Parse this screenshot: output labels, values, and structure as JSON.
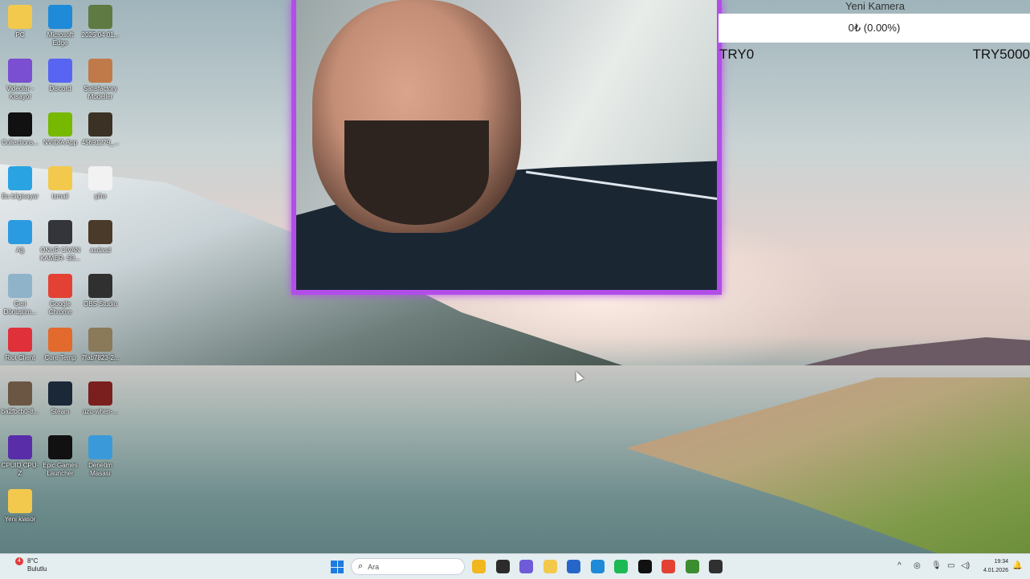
{
  "desktop": {
    "icons": [
      {
        "label": "PC",
        "icon": "folder-icon",
        "color": "#f2c94c"
      },
      {
        "label": "Microsoft Edge",
        "icon": "edge-icon",
        "color": "#1f8ad8"
      },
      {
        "label": "2025 04 01...",
        "icon": "image-file-icon",
        "color": "#5f7a42"
      },
      {
        "label": "Videolar - Kısayol",
        "icon": "video-folder-icon",
        "color": "#7a4fd1"
      },
      {
        "label": "Discord",
        "icon": "discord-icon",
        "color": "#5865f2"
      },
      {
        "label": "Satisfactory Modeller",
        "icon": "mug-icon",
        "color": "#c07a4a"
      },
      {
        "label": "Collections...",
        "icon": "black-window-icon",
        "color": "#111111"
      },
      {
        "label": "NVIDIA App",
        "icon": "nvidia-icon",
        "color": "#76b900"
      },
      {
        "label": "45691279_...",
        "icon": "image-file-icon",
        "color": "#3b3124"
      },
      {
        "label": "Bu bilgisayar",
        "icon": "monitor-icon",
        "color": "#2aa3e2"
      },
      {
        "label": "ismail",
        "icon": "folder-icon",
        "color": "#f2c94c"
      },
      {
        "label": "şifre",
        "icon": "text-file-icon",
        "color": "#f2f2f2"
      },
      {
        "label": "Ağ",
        "icon": "network-icon",
        "color": "#2a9be0"
      },
      {
        "label": "ONUR CIVAN KAMER- S3...",
        "icon": "image-file-icon",
        "color": "#33353a"
      },
      {
        "label": "asdasd",
        "icon": "image-file-icon",
        "color": "#4a3a2a"
      },
      {
        "label": "Geri Dönüşüm...",
        "icon": "recycle-bin-icon",
        "color": "#8fb3c9"
      },
      {
        "label": "Google Chrome",
        "icon": "chrome-icon",
        "color": "#e34133"
      },
      {
        "label": "OBS Studio",
        "icon": "obs-icon",
        "color": "#303030"
      },
      {
        "label": "Riot Client",
        "icon": "riot-icon",
        "color": "#e0303a"
      },
      {
        "label": "Core Temp",
        "icon": "thermometer-icon",
        "color": "#e26a2c"
      },
      {
        "label": "7fab7823-2...",
        "icon": "image-file-icon",
        "color": "#8a7a5a"
      },
      {
        "label": "ba2fbcb0-8...",
        "icon": "image-file-icon",
        "color": "#6b5644"
      },
      {
        "label": "Steam",
        "icon": "steam-icon",
        "color": "#1b2838"
      },
      {
        "label": "uzu-when-...",
        "icon": "image-file-icon",
        "color": "#7a1e1e"
      },
      {
        "label": "CPUID CPU-Z",
        "icon": "cpuz-icon",
        "color": "#5a2da8"
      },
      {
        "label": "Epic Games Launcher",
        "icon": "epic-games-icon",
        "color": "#111111"
      },
      {
        "label": "Denetim Masası",
        "icon": "control-panel-icon",
        "color": "#3a9ad9"
      },
      {
        "label": "Yeni klasör",
        "icon": "folder-icon",
        "color": "#f2c94c"
      }
    ]
  },
  "widget": {
    "camera_label": "Yeni Kamera",
    "price": "0₺ (0.00%)",
    "range_min": "TRY0",
    "range_max": "TRY5000"
  },
  "taskbar": {
    "weather_temp": "8°C",
    "weather_desc": "Bulutlu",
    "notification_count": "4",
    "search_placeholder": "Ara",
    "apps": [
      {
        "name": "file-explorer-icon",
        "color": "#f2b61f"
      },
      {
        "name": "terminal-icon",
        "color": "#2b2b2b"
      },
      {
        "name": "copilot-icon",
        "color": "#6f5bd8"
      },
      {
        "name": "folder-icon",
        "color": "#f2c94c"
      },
      {
        "name": "store-icon",
        "color": "#2766c9"
      },
      {
        "name": "edge-icon",
        "color": "#1f8ad8"
      },
      {
        "name": "spotify-icon",
        "color": "#1db954"
      },
      {
        "name": "apple-tv-icon",
        "color": "#111111"
      },
      {
        "name": "chrome-icon",
        "color": "#e34133"
      },
      {
        "name": "minecraft-icon",
        "color": "#3c8d2f"
      },
      {
        "name": "obs-icon",
        "color": "#303030"
      }
    ],
    "time": "19:34",
    "date": "4.01.2026"
  }
}
